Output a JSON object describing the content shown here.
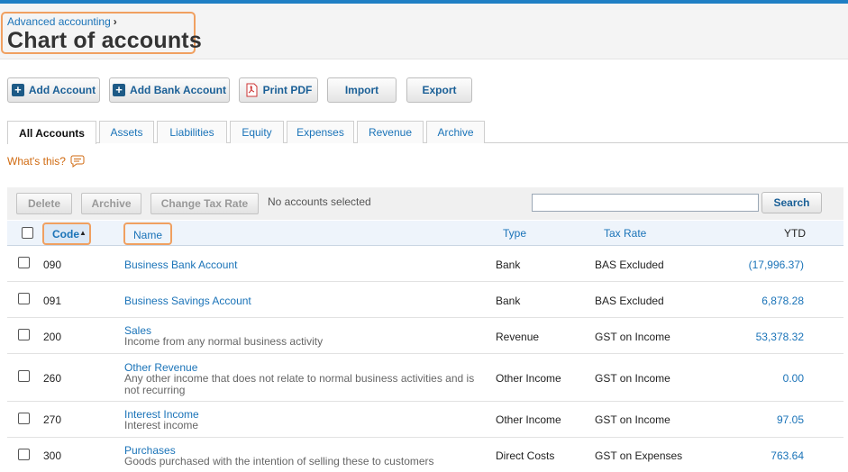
{
  "header": {
    "breadcrumb": "Advanced accounting",
    "breadcrumb_sep": "›",
    "title": "Chart of accounts"
  },
  "actions": {
    "add_account": "Add Account",
    "add_bank_account": "Add Bank Account",
    "print_pdf": "Print PDF",
    "import": "Import",
    "export": "Export"
  },
  "tabs": [
    {
      "label": "All Accounts",
      "active": true
    },
    {
      "label": "Assets"
    },
    {
      "label": "Liabilities"
    },
    {
      "label": "Equity"
    },
    {
      "label": "Expenses"
    },
    {
      "label": "Revenue"
    },
    {
      "label": "Archive"
    }
  ],
  "help": {
    "whats_this": "What's this?"
  },
  "toolbar": {
    "delete": "Delete",
    "archive": "Archive",
    "change_tax_rate": "Change Tax Rate",
    "selection_status": "No accounts selected",
    "search_value": "",
    "search_button": "Search"
  },
  "table": {
    "columns": {
      "code": "Code",
      "name": "Name",
      "type": "Type",
      "tax_rate": "Tax Rate",
      "ytd": "YTD"
    },
    "sort_indicator": "▲",
    "rows": [
      {
        "code": "090",
        "name": "Business Bank Account",
        "description": "",
        "type": "Bank",
        "tax_rate": "BAS Excluded",
        "ytd": "(17,996.37)"
      },
      {
        "code": "091",
        "name": "Business Savings Account",
        "description": "",
        "type": "Bank",
        "tax_rate": "BAS Excluded",
        "ytd": "6,878.28"
      },
      {
        "code": "200",
        "name": "Sales",
        "description": "Income from any normal business activity",
        "type": "Revenue",
        "tax_rate": "GST on Income",
        "ytd": "53,378.32"
      },
      {
        "code": "260",
        "name": "Other Revenue",
        "description": "Any other income that does not relate to normal business activities and is not recurring",
        "type": "Other Income",
        "tax_rate": "GST on Income",
        "ytd": "0.00"
      },
      {
        "code": "270",
        "name": "Interest Income",
        "description": "Interest income",
        "type": "Other Income",
        "tax_rate": "GST on Income",
        "ytd": "97.05"
      },
      {
        "code": "300",
        "name": "Purchases",
        "description": "Goods purchased with the intention of selling these to customers",
        "type": "Direct Costs",
        "tax_rate": "GST on Expenses",
        "ytd": "763.64"
      }
    ]
  },
  "colors": {
    "accent": "#1a73b8",
    "highlight": "#f0a060",
    "topbar": "#1f7fc4"
  }
}
